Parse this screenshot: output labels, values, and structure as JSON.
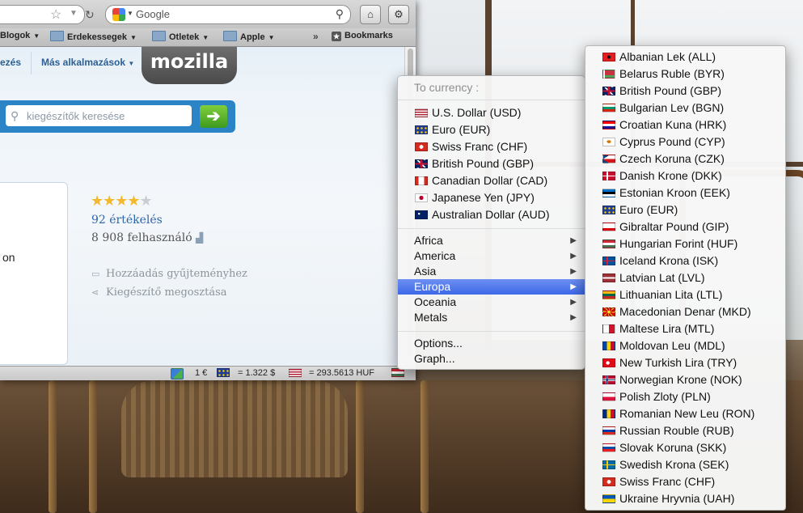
{
  "browser": {
    "search_placeholder": "Google",
    "bookmarks": [
      {
        "label": "Blogok"
      },
      {
        "label": "Erdekessegek"
      },
      {
        "label": "Otletek"
      },
      {
        "label": "Apple"
      }
    ],
    "bookmarks_menu": "Bookmarks",
    "more_glyph": "»"
  },
  "page": {
    "nav_left": "ezés",
    "nav_more": "Más alkalmazások",
    "logo": "mozilla",
    "search_placeholder": "kiegészítők keresése",
    "card_text": "on",
    "reviews": "92 értékelés",
    "users": "8 908 felhasználó",
    "add_collection": "Hozzáadás gyűjteményhez",
    "share": "Kiegészítő megosztása",
    "rating": 4,
    "rating_max": 5
  },
  "statusbar": {
    "amount": "1 €",
    "usd": "= 1.322 $",
    "huf": "= 293.5613 HUF"
  },
  "menu": {
    "header": "To currency :",
    "currencies": [
      {
        "label": "U.S. Dollar (USD)",
        "flag": "us"
      },
      {
        "label": "Euro (EUR)",
        "flag": "eu"
      },
      {
        "label": "Swiss Franc (CHF)",
        "flag": "ch"
      },
      {
        "label": "British Pound (GBP)",
        "flag": "gb"
      },
      {
        "label": "Canadian Dollar (CAD)",
        "flag": "ca"
      },
      {
        "label": "Japanese Yen (JPY)",
        "flag": "jp"
      },
      {
        "label": "Australian Dollar (AUD)",
        "flag": "au"
      }
    ],
    "regions": [
      {
        "label": "Africa"
      },
      {
        "label": "America"
      },
      {
        "label": "Asia"
      },
      {
        "label": "Europa",
        "selected": true
      },
      {
        "label": "Oceania"
      },
      {
        "label": "Metals"
      }
    ],
    "options": "Options...",
    "graph": "Graph...",
    "selected_color": "#3d68e8"
  },
  "submenu": {
    "items": [
      {
        "label": "Albanian Lek (ALL)",
        "flag": "al"
      },
      {
        "label": "Belarus Ruble (BYR)",
        "flag": "by"
      },
      {
        "label": "British Pound (GBP)",
        "flag": "gb"
      },
      {
        "label": "Bulgarian Lev (BGN)",
        "flag": "bg"
      },
      {
        "label": "Croatian Kuna (HRK)",
        "flag": "hr"
      },
      {
        "label": "Cyprus Pound (CYP)",
        "flag": "cy"
      },
      {
        "label": "Czech Koruna (CZK)",
        "flag": "cz"
      },
      {
        "label": "Danish Krone (DKK)",
        "flag": "dk"
      },
      {
        "label": "Estonian Kroon (EEK)",
        "flag": "ee"
      },
      {
        "label": "Euro (EUR)",
        "flag": "eu"
      },
      {
        "label": "Gibraltar Pound (GIP)",
        "flag": "gi"
      },
      {
        "label": "Hungarian Forint (HUF)",
        "flag": "hu"
      },
      {
        "label": "Iceland Krona (ISK)",
        "flag": "is"
      },
      {
        "label": "Latvian Lat (LVL)",
        "flag": "lv"
      },
      {
        "label": "Lithuanian Lita (LTL)",
        "flag": "lt"
      },
      {
        "label": "Macedonian Denar (MKD)",
        "flag": "mk"
      },
      {
        "label": "Maltese Lira (MTL)",
        "flag": "mt"
      },
      {
        "label": "Moldovan Leu (MDL)",
        "flag": "md"
      },
      {
        "label": "New Turkish Lira (TRY)",
        "flag": "tr"
      },
      {
        "label": "Norwegian Krone (NOK)",
        "flag": "no"
      },
      {
        "label": "Polish Zloty (PLN)",
        "flag": "pl"
      },
      {
        "label": "Romanian New Leu (RON)",
        "flag": "ro"
      },
      {
        "label": "Russian Rouble (RUB)",
        "flag": "ru"
      },
      {
        "label": "Slovak Koruna (SKK)",
        "flag": "sk"
      },
      {
        "label": "Swedish Krona (SEK)",
        "flag": "se"
      },
      {
        "label": "Swiss Franc (CHF)",
        "flag": "ch"
      },
      {
        "label": "Ukraine Hryvnia (UAH)",
        "flag": "ua"
      }
    ]
  }
}
